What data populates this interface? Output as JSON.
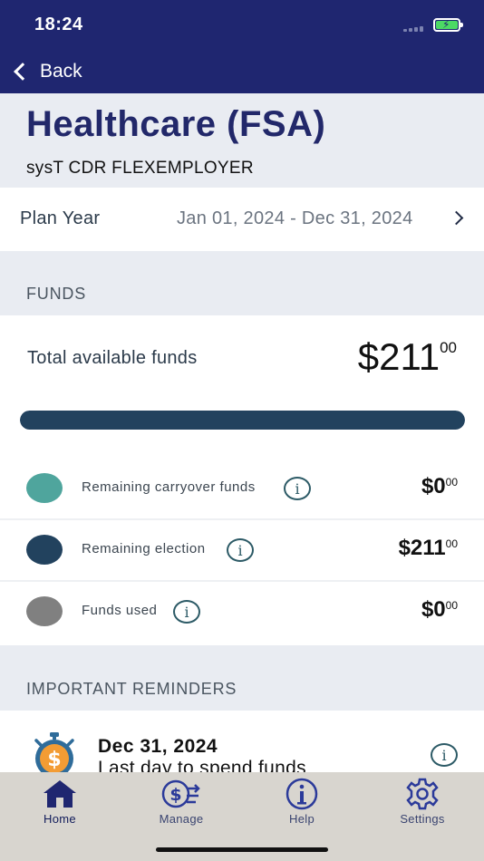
{
  "status": {
    "time": "18:24"
  },
  "nav": {
    "back_label": "Back"
  },
  "header": {
    "title": "Healthcare (FSA)",
    "employer": "sysT CDR FLEXEMPLOYER"
  },
  "plan_year": {
    "label": "Plan Year",
    "value": "Jan 01, 2024 - Dec 31, 2024"
  },
  "funds": {
    "section_label": "FUNDS",
    "total_label": "Total available funds",
    "total_main": "$211",
    "total_cents": "00",
    "progress_fraction": 1.0,
    "rows": [
      {
        "label": "Remaining carryover funds",
        "amount_main": "$0",
        "amount_cents": "00",
        "color": "#4fa59d"
      },
      {
        "label": "Remaining election",
        "amount_main": "$211",
        "amount_cents": "00",
        "color": "#22425e"
      },
      {
        "label": "Funds used",
        "amount_main": "$0",
        "amount_cents": "00",
        "color": "#808080"
      }
    ]
  },
  "reminders": {
    "section_label": "IMPORTANT REMINDERS",
    "items": [
      {
        "date": "Dec 31, 2024",
        "text": "Last day to spend funds"
      }
    ]
  },
  "tabs": [
    {
      "label": "Home",
      "icon": "home-icon"
    },
    {
      "label": "Manage",
      "icon": "dollar-transfer-icon"
    },
    {
      "label": "Help",
      "icon": "info-icon"
    },
    {
      "label": "Settings",
      "icon": "gear-icon"
    }
  ],
  "info_glyph": "i",
  "colors": {
    "brand": "#1f2670",
    "accent_orange": "#f39c34",
    "tab_bar": "#d8d5cf"
  }
}
